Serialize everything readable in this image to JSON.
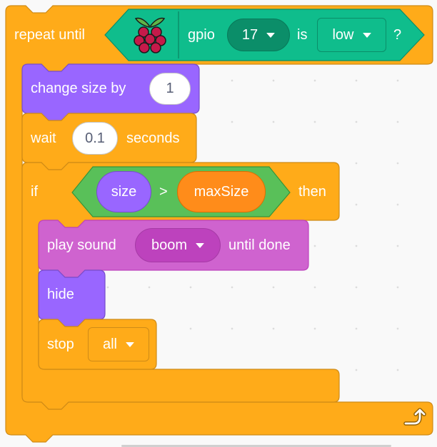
{
  "colors": {
    "control": "#ffab19",
    "control_dark": "#cf8b17",
    "looks": "#9966ff",
    "looks_dark": "#774dcb",
    "sound": "#cf63cf",
    "sound_dark": "#bd42bd",
    "operators": "#59c059",
    "operators_dark": "#389438",
    "gpio": "#0fbd8c",
    "gpio_dark": "#0b8e69",
    "variable": "#ff8c1a",
    "variable_dark": "#db6e00"
  },
  "repeat_until": {
    "label": "repeat until",
    "condition": {
      "gpio_label": "gpio",
      "pin_value": "17",
      "is_label": "is",
      "state_value": "low",
      "question_label": "?",
      "extension_icon": "raspberry-pi-icon"
    },
    "loop_icon": "loop-arrow-icon"
  },
  "change_size": {
    "label": "change size by",
    "value": "1"
  },
  "wait": {
    "label": "wait",
    "value": "0.1",
    "suffix": "seconds"
  },
  "if_block": {
    "label": "if",
    "then_label": "then",
    "condition": {
      "left": "size",
      "operator": ">",
      "right": "maxSize"
    }
  },
  "play_sound": {
    "label": "play sound",
    "sound_value": "boom",
    "suffix": "until done"
  },
  "hide": {
    "label": "hide"
  },
  "stop": {
    "label": "stop",
    "option_value": "all"
  }
}
